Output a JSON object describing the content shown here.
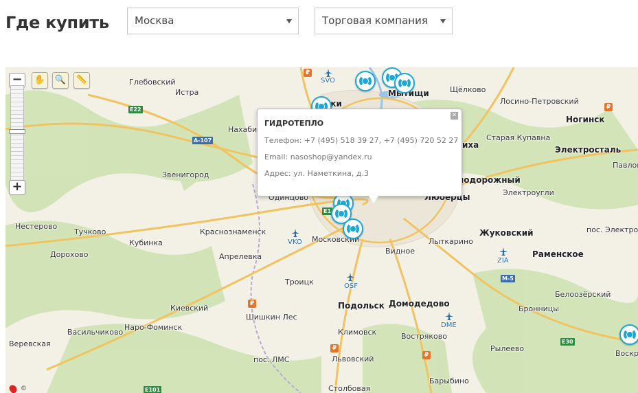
{
  "page": {
    "title": "Где купить"
  },
  "filters": {
    "city": "Москва",
    "company_type": "Торговая компания"
  },
  "balloon": {
    "name": "ГИДРОТЕПЛО",
    "phone": "Телефон: +7 (495) 518 39 27, +7 (495) 720 52 27",
    "email": "Email: nasoshop@yandex.ru",
    "address": "Адрес: ул. Наметкина, д.3"
  },
  "map": {
    "cities": [
      "Глебовский",
      "Истра",
      "Нахаби",
      "Звенигород",
      "Одинцово",
      "Нестерово",
      "Тучково",
      "Кубинка",
      "Краснознаменск",
      "Московский",
      "Дорохово",
      "Апрелевка",
      "Троицк",
      "Видное",
      "Лыткарино",
      "Киевский",
      "Шишкин Лес",
      "Наро-Фоминск",
      "Васильчиково",
      "Веревская",
      "Климовск",
      "пос. ЛМС",
      "Львовский",
      "Востряково",
      "Рылеево",
      "Барыбино",
      "Столбовая",
      "Лосино-Петровский",
      "Ногинск",
      "Старая Купавна",
      "Электросталь",
      "Павлов Пос",
      "Электроугли",
      "Раменское",
      "пос. Электроизолятор",
      "Белоозёрский",
      "Бронницы",
      "Воскр",
      "Щёлково",
      "Мытищи",
      "ики",
      "иха",
      "нодорожный"
    ],
    "big_cities": [
      "Мытищи",
      "Люберцы",
      "Подольск",
      "Домодедово",
      "Жуковский",
      "Ногинск",
      "Электросталь",
      "Раменское"
    ],
    "airports": [
      "SVO",
      "VKO",
      "OSF",
      "DME",
      "ZIA"
    ],
    "roads": [
      "E22",
      "A-107",
      "E101",
      "E30",
      "M-5",
      "E1"
    ],
    "rail_symbol": "₽",
    "copyright_partial": "©"
  },
  "colors": {
    "marker": "#1aa8d8",
    "balloon_border": "#bbbbbb",
    "map_bg": "#f3f0e6"
  }
}
